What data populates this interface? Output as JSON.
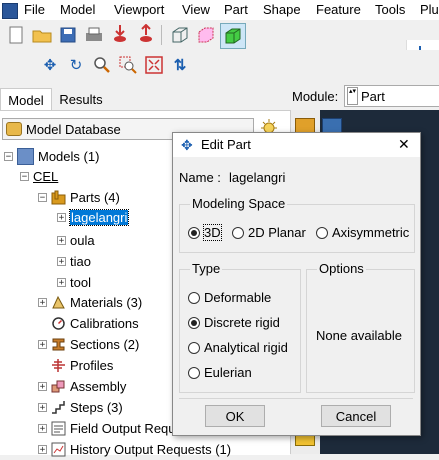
{
  "menubar": {
    "items": [
      "File",
      "Model",
      "Viewport",
      "View",
      "Part",
      "Shape",
      "Feature",
      "Tools",
      "Plu"
    ]
  },
  "tabs": [
    "Model",
    "Results"
  ],
  "module": {
    "label": "Module:",
    "value": "Part"
  },
  "model_database": {
    "label": "Model Database"
  },
  "tree": {
    "models": "Models (1)",
    "cel": "CEL",
    "parts": "Parts (4)",
    "part_items": [
      "lagelangri",
      "oula",
      "tiao",
      "tool"
    ],
    "materials": "Materials (3)",
    "calibrations": "Calibrations",
    "sections": "Sections (2)",
    "profiles": "Profiles",
    "assembly": "Assembly",
    "steps": "Steps (3)",
    "field_output": "Field Output Requ",
    "history_output": "History Output Requests (1)"
  },
  "dialog": {
    "title": "Edit Part",
    "close": "✕",
    "name_label": "Name :",
    "name_value": "lagelangri",
    "modeling_space": {
      "title": "Modeling Space",
      "options": [
        "3D",
        "2D Planar",
        "Axisymmetric"
      ],
      "selected": "3D"
    },
    "type": {
      "title": "Type",
      "options": [
        "Deformable",
        "Discrete rigid",
        "Analytical rigid",
        "Eulerian"
      ],
      "selected": "Discrete rigid"
    },
    "options_group": {
      "title": "Options",
      "text": "None available"
    },
    "ok": "OK",
    "cancel": "Cancel"
  },
  "colors": {
    "viewport_bg": "#1d2a3a",
    "selection": "#0078d7",
    "parts_folder": "#d99a1e"
  }
}
